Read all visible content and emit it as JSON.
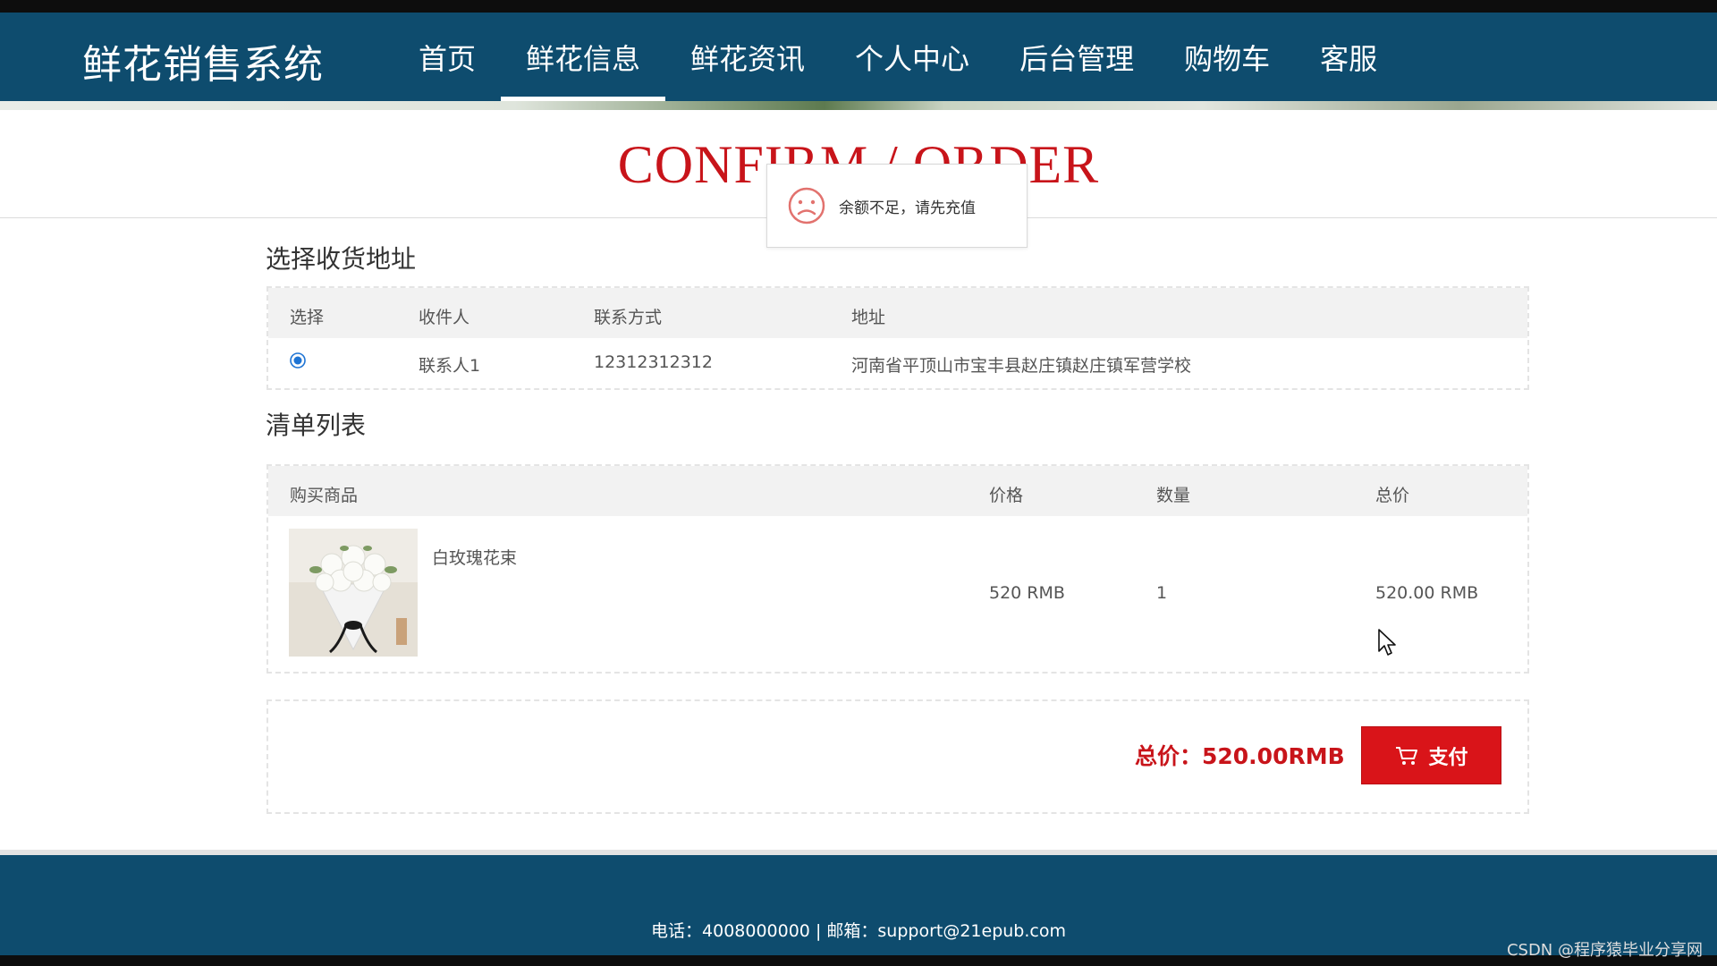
{
  "app": {
    "brand": "鲜花销售系统"
  },
  "nav": {
    "items": [
      {
        "label": "首页"
      },
      {
        "label": "鲜花信息"
      },
      {
        "label": "鲜花资讯"
      },
      {
        "label": "个人中心"
      },
      {
        "label": "后台管理"
      },
      {
        "label": "购物车"
      },
      {
        "label": "客服"
      }
    ],
    "active": "鲜花信息"
  },
  "page": {
    "title": "CONFIRM / ORDER"
  },
  "toast": {
    "message": "余额不足，请先充值",
    "icon": "sad-face-icon"
  },
  "address": {
    "section_title": "选择收货地址",
    "headers": {
      "select": "选择",
      "recipient": "收件人",
      "contact": "联系方式",
      "address": "地址"
    },
    "rows": [
      {
        "selected": true,
        "recipient": "联系人1",
        "contact": "12312312312",
        "address": "河南省平顶山市宝丰县赵庄镇赵庄镇军营学校"
      }
    ]
  },
  "order_list": {
    "section_title": "清单列表",
    "headers": {
      "product": "购买商品",
      "price": "价格",
      "quantity": "数量",
      "subtotal": "总价"
    },
    "items": [
      {
        "name": "白玫瑰花束",
        "price": "520 RMB",
        "quantity": "1",
        "subtotal": "520.00 RMB"
      }
    ]
  },
  "summary": {
    "total": "总价：520.00RMB",
    "pay_label": "支付"
  },
  "footer": {
    "contact": "电话：4008000000 | 邮箱：support@21epub.com"
  },
  "watermark": "CSDN @程序猿毕业分享网",
  "colors": {
    "nav_bg": "#0e4c6e",
    "accent_red": "#d91419",
    "title_red": "#c8141a"
  }
}
